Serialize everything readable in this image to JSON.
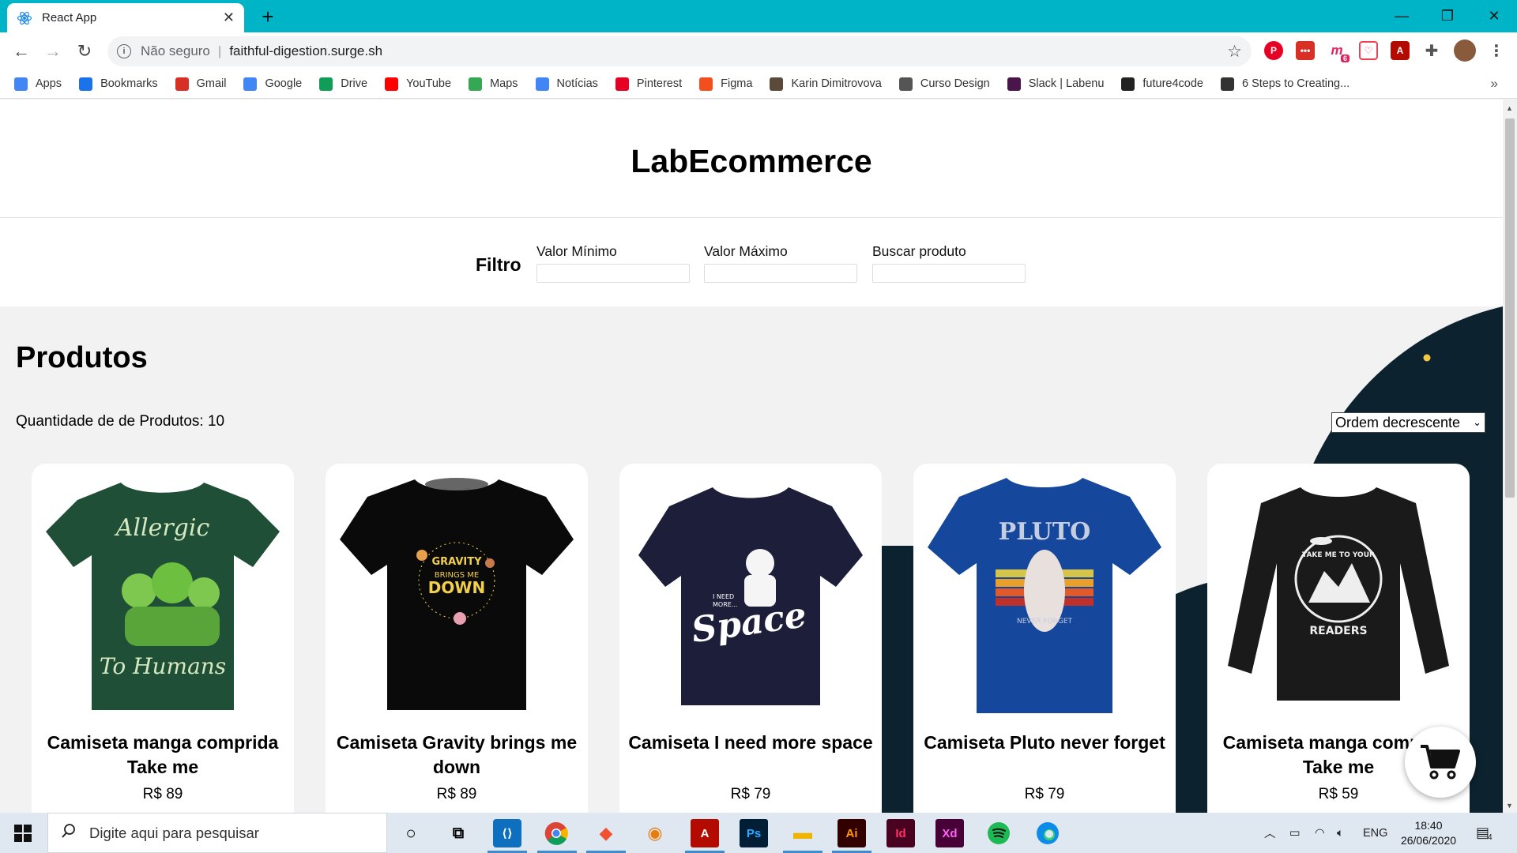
{
  "browser": {
    "tab_title": "React App",
    "security_label": "Não seguro",
    "url": "faithful-digestion.surge.sh",
    "extension_badge": "6",
    "bookmarks": [
      {
        "label": "Apps",
        "icon": "apps-grid-icon",
        "color": "#4285f4"
      },
      {
        "label": "Bookmarks",
        "icon": "star-icon",
        "color": "#1a73e8"
      },
      {
        "label": "Gmail",
        "icon": "gmail-icon",
        "color": "#d93025"
      },
      {
        "label": "Google",
        "icon": "google-icon",
        "color": "#4285f4"
      },
      {
        "label": "Drive",
        "icon": "drive-icon",
        "color": "#0f9d58"
      },
      {
        "label": "YouTube",
        "icon": "youtube-icon",
        "color": "#ff0000"
      },
      {
        "label": "Maps",
        "icon": "maps-icon",
        "color": "#34a853"
      },
      {
        "label": "Notícias",
        "icon": "news-icon",
        "color": "#4285f4"
      },
      {
        "label": "Pinterest",
        "icon": "pinterest-icon",
        "color": "#e60023"
      },
      {
        "label": "Figma",
        "icon": "figma-icon",
        "color": "#f24e1e"
      },
      {
        "label": "Karin Dimitrovova",
        "icon": "profile-image-icon",
        "color": "#5a4a3a"
      },
      {
        "label": "Curso Design",
        "icon": "globe-icon",
        "color": "#555555"
      },
      {
        "label": "Slack | Labenu",
        "icon": "slack-icon",
        "color": "#4a154b"
      },
      {
        "label": "future4code",
        "icon": "github-icon",
        "color": "#222222"
      },
      {
        "label": "6 Steps to Creating...",
        "icon": "dark-circle-icon",
        "color": "#333333"
      }
    ],
    "more_bookmarks": "»"
  },
  "page": {
    "title": "LabEcommerce",
    "filter": {
      "label": "Filtro",
      "min_label": "Valor Mínimo",
      "max_label": "Valor Máximo",
      "search_label": "Buscar produto",
      "min_value": "",
      "max_value": "",
      "search_value": ""
    },
    "products_heading": "Produtos",
    "quantity_text": "Quantidade de de Produtos: 10",
    "order_selected": "Ordem decrescente",
    "products": [
      {
        "name": "Camiseta manga comprida Take me",
        "price": "R$ 89",
        "shirt_color": "#1f4f37",
        "print": "Allergic To Humans"
      },
      {
        "name": "Camiseta Gravity brings me down",
        "price": "R$ 89",
        "shirt_color": "#0a0a0a",
        "print": "GRAVITY BRINGS ME DOWN"
      },
      {
        "name": "Camiseta I need more space",
        "price": "R$ 79",
        "shirt_color": "#1d1f3a",
        "print": "I NEED MORE... Space"
      },
      {
        "name": "Camiseta Pluto never forget",
        "price": "R$ 79",
        "shirt_color": "#15479c",
        "print": "PLUTO"
      },
      {
        "name": "Camiseta manga comprida Take me",
        "price": "R$ 59",
        "shirt_color": "#1a1a1a",
        "print": "TAKE ME TO YOUR READERS"
      }
    ]
  },
  "taskbar": {
    "search_placeholder": "Digite aqui para pesquisar",
    "language": "ENG",
    "time": "18:40",
    "date": "26/06/2020",
    "notification_count": "4"
  },
  "colors": {
    "chrome_accent": "#00b4c8",
    "deco_dark": "#0c222e",
    "deco_dot": "#f2c744"
  }
}
